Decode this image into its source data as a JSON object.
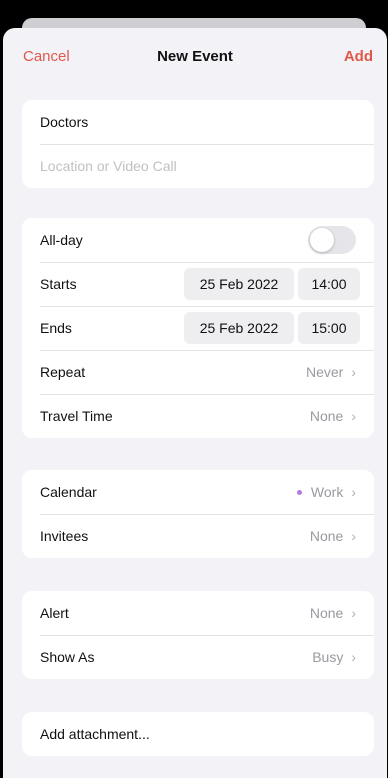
{
  "nav": {
    "cancel": "Cancel",
    "title": "New Event",
    "add": "Add"
  },
  "colors": {
    "accent": "#e0584a",
    "calendar_work": "#b57bd6"
  },
  "event": {
    "title": "Doctors",
    "location_placeholder": "Location or Video Call"
  },
  "timing": {
    "allday_label": "All-day",
    "allday_on": false,
    "starts_label": "Starts",
    "starts_date": "25 Feb 2022",
    "starts_time": "14:00",
    "ends_label": "Ends",
    "ends_date": "25 Feb 2022",
    "ends_time": "15:00",
    "repeat_label": "Repeat",
    "repeat_value": "Never",
    "travel_label": "Travel Time",
    "travel_value": "None"
  },
  "calendar": {
    "calendar_label": "Calendar",
    "calendar_value": "Work",
    "invitees_label": "Invitees",
    "invitees_value": "None"
  },
  "alerts": {
    "alert_label": "Alert",
    "alert_value": "None",
    "showas_label": "Show As",
    "showas_value": "Busy"
  },
  "attachment": {
    "label": "Add attachment..."
  },
  "icons": {
    "chevron": "chevron-right-icon",
    "calendar_dot": "dot-icon"
  }
}
